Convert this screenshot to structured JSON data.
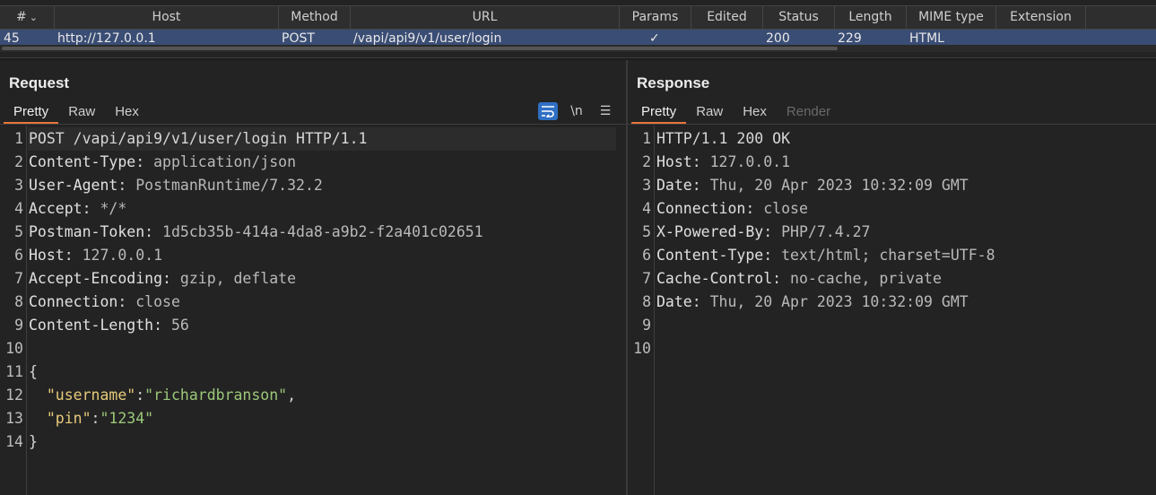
{
  "history": {
    "columns": [
      {
        "label": "#",
        "sort": "⌄"
      },
      {
        "label": "Host"
      },
      {
        "label": "Method"
      },
      {
        "label": "URL"
      },
      {
        "label": "Params"
      },
      {
        "label": "Edited"
      },
      {
        "label": "Status"
      },
      {
        "label": "Length"
      },
      {
        "label": "MIME type"
      },
      {
        "label": "Extension"
      }
    ],
    "row": {
      "num": "45",
      "host": "http://127.0.0.1",
      "method": "POST",
      "url": "/vapi/api9/v1/user/login",
      "params": "✓",
      "edited": "",
      "status": "200",
      "length": "229",
      "mime": "HTML",
      "extension": ""
    }
  },
  "request": {
    "title": "Request",
    "tabs": [
      "Pretty",
      "Raw",
      "Hex"
    ],
    "tools": {
      "wrap": "⥱",
      "newline": "\\n",
      "menu": "☰"
    },
    "lines": [
      {
        "n": "1",
        "k": "POST /vapi/api9/v1/user/login HTTP/1.1",
        "v": ""
      },
      {
        "n": "2",
        "k": "Content-Type",
        "v": "application/json"
      },
      {
        "n": "3",
        "k": "User-Agent",
        "v": "PostmanRuntime/7.32.2"
      },
      {
        "n": "4",
        "k": "Accept",
        "v": "*/*"
      },
      {
        "n": "5",
        "k": "Postman-Token",
        "v": "1d5cb35b-414a-4da8-a9b2-f2a401c02651"
      },
      {
        "n": "6",
        "k": "Host",
        "v": "127.0.0.1"
      },
      {
        "n": "7",
        "k": "Accept-Encoding",
        "v": "gzip, deflate"
      },
      {
        "n": "8",
        "k": "Connection",
        "v": "close"
      },
      {
        "n": "9",
        "k": "Content-Length",
        "v": "56"
      },
      {
        "n": "10",
        "k": "",
        "v": ""
      },
      {
        "n": "11",
        "k": "{",
        "v": ""
      },
      {
        "n": "12",
        "k": "\"username\"",
        "v": "\"richardbranson\""
      },
      {
        "n": "13",
        "k": "\"pin\"",
        "v": "\"1234\""
      },
      {
        "n": "14",
        "k": "}",
        "v": ""
      }
    ]
  },
  "response": {
    "title": "Response",
    "tabs": [
      "Pretty",
      "Raw",
      "Hex",
      "Render"
    ],
    "lines": [
      {
        "n": "1",
        "k": "HTTP/1.1 200 OK",
        "v": ""
      },
      {
        "n": "2",
        "k": "Host",
        "v": "127.0.0.1"
      },
      {
        "n": "3",
        "k": "Date",
        "v": "Thu, 20 Apr 2023 10:32:09 GMT"
      },
      {
        "n": "4",
        "k": "Connection",
        "v": "close"
      },
      {
        "n": "5",
        "k": "X-Powered-By",
        "v": "PHP/7.4.27"
      },
      {
        "n": "6",
        "k": "Content-Type",
        "v": "text/html; charset=UTF-8"
      },
      {
        "n": "7",
        "k": "Cache-Control",
        "v": "no-cache, private"
      },
      {
        "n": "8",
        "k": "Date",
        "v": "Thu, 20 Apr 2023 10:32:09 GMT"
      },
      {
        "n": "9",
        "k": "",
        "v": ""
      },
      {
        "n": "10",
        "k": "",
        "v": ""
      }
    ]
  },
  "colors": {
    "accent": "#e8743b",
    "selected_row": "#3a4d74",
    "json_key": "#e6c97a",
    "json_string": "#9cc879"
  }
}
